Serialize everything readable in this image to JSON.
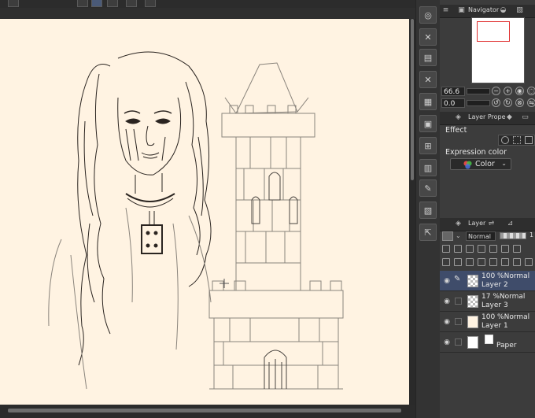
{
  "navigator": {
    "tab_label": "Navigator",
    "zoom_value": "66.6",
    "rotation_value": "0.0"
  },
  "layer_property": {
    "tab_label": "Layer Prope",
    "effect_label": "Effect",
    "expression_color_label": "Expression color",
    "expression_color_value": "Color"
  },
  "layer_panel": {
    "tab_label": "Layer",
    "blend_mode": "Normal",
    "opacity_partial": "1",
    "layers": [
      {
        "opacity_blend": "100 %Normal",
        "name": "Layer 2",
        "selected": true
      },
      {
        "opacity_blend": "17 %Normal",
        "name": "Layer 3",
        "selected": false
      },
      {
        "opacity_blend": "100 %Normal",
        "name": "Layer 1",
        "selected": false
      },
      {
        "opacity_blend": "",
        "name": "Paper",
        "selected": false
      }
    ]
  },
  "canvas": {
    "paper_color": "#fff3e2",
    "line_color": "#2a2420"
  },
  "colors": {
    "selected_layer": "#3f4c6a",
    "navigator_frame": "#e03030"
  }
}
